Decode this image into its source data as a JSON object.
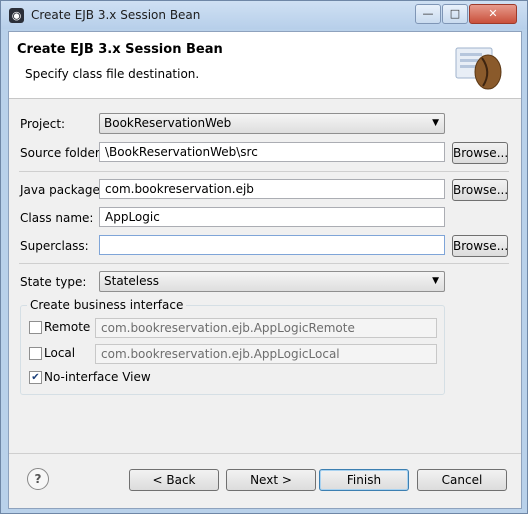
{
  "window": {
    "title": "Create EJB 3.x Session Bean"
  },
  "header": {
    "title": "Create EJB 3.x Session Bean",
    "subtitle": "Specify class file destination."
  },
  "form": {
    "project": {
      "label": "Project:",
      "value": "BookReservationWeb"
    },
    "source_folder": {
      "label": "Source folder:",
      "value": "\\BookReservationWeb\\src",
      "button": "Browse..."
    },
    "java_package": {
      "label": "Java package:",
      "value": "com.bookreservation.ejb",
      "button": "Browse..."
    },
    "class_name": {
      "label": "Class name:",
      "value": "AppLogic"
    },
    "superclass": {
      "label": "Superclass:",
      "value": "",
      "button": "Browse..."
    },
    "state_type": {
      "label": "State type:",
      "value": "Stateless"
    },
    "business_interface": {
      "title": "Create business interface",
      "remote": {
        "label": "Remote",
        "checked": false,
        "value": "com.bookreservation.ejb.AppLogicRemote"
      },
      "local": {
        "label": "Local",
        "checked": false,
        "value": "com.bookreservation.ejb.AppLogicLocal"
      },
      "no_interface": {
        "label": "No-interface View",
        "checked": true
      }
    }
  },
  "footer": {
    "back": "< Back",
    "next": "Next >",
    "finish": "Finish",
    "cancel": "Cancel",
    "help": "?"
  },
  "colors": {
    "titlebar": "#b9d1ea",
    "dialog_bg": "#f0f0f0",
    "close_button": "#c9503b"
  }
}
